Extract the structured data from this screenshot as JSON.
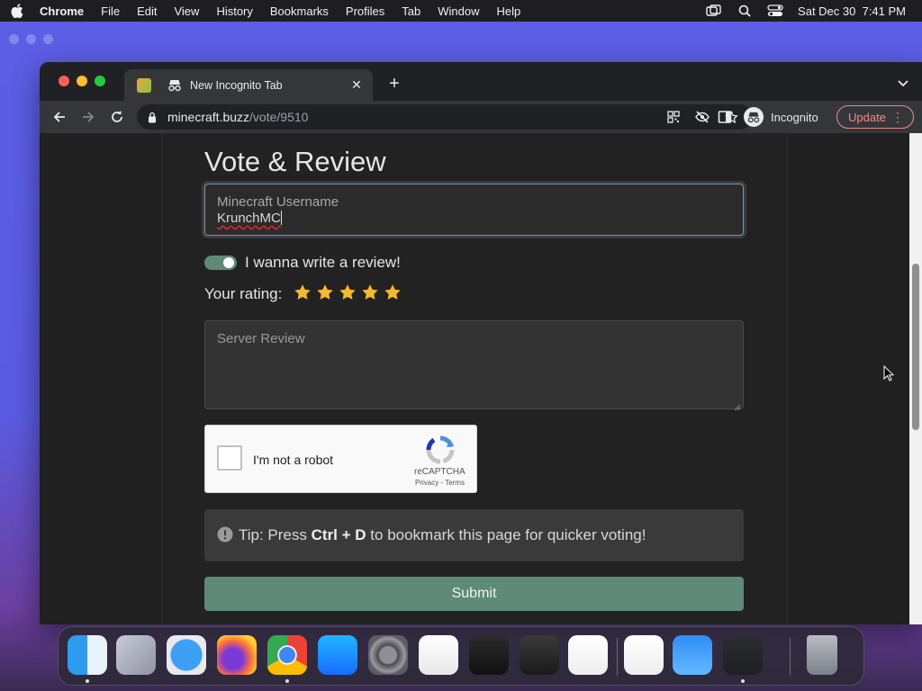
{
  "menubar": {
    "app_name": "Chrome",
    "items": [
      "File",
      "Edit",
      "View",
      "History",
      "Bookmarks",
      "Profiles",
      "Tab",
      "Window",
      "Help"
    ],
    "clock": "Sat Dec 30  7:41 PM"
  },
  "browser": {
    "tab_title": "New Incognito Tab",
    "url_host": "minecraft.buzz",
    "url_path": "/vote/9510",
    "profile_label": "Incognito",
    "update_label": "Update"
  },
  "page": {
    "title": "Vote & Review",
    "username_label": "Minecraft Username",
    "username_value": "KrunchMC",
    "review_toggle_label": "I wanna write a review!",
    "review_toggle_on": true,
    "rating_label": "Your rating:",
    "rating_value": 5,
    "rating_max": 5,
    "review_placeholder": "Server Review",
    "captcha_label": "I'm not a robot",
    "captcha_brand": "reCAPTCHA",
    "captcha_links": "Privacy - Terms",
    "tip_prefix": "Tip: Press",
    "tip_keys": "Ctrl + D",
    "tip_suffix": "to bookmark this page for quicker voting!",
    "submit_label": "Submit"
  },
  "colors": {
    "accent_green": "#5e8a77",
    "star": "#f5b82e",
    "update_red": "#f28b82"
  },
  "dock": {
    "apps": [
      "finder-icon",
      "launchpad-icon",
      "safari-icon",
      "firefox-icon",
      "chrome-icon",
      "app-store-icon",
      "system-settings-icon",
      "textedit-icon",
      "terminal-icon",
      "garageband-icon",
      "vscode-icon",
      "visual-studio-icon",
      "weather-icon",
      "discord-icon",
      "trash-icon"
    ]
  }
}
